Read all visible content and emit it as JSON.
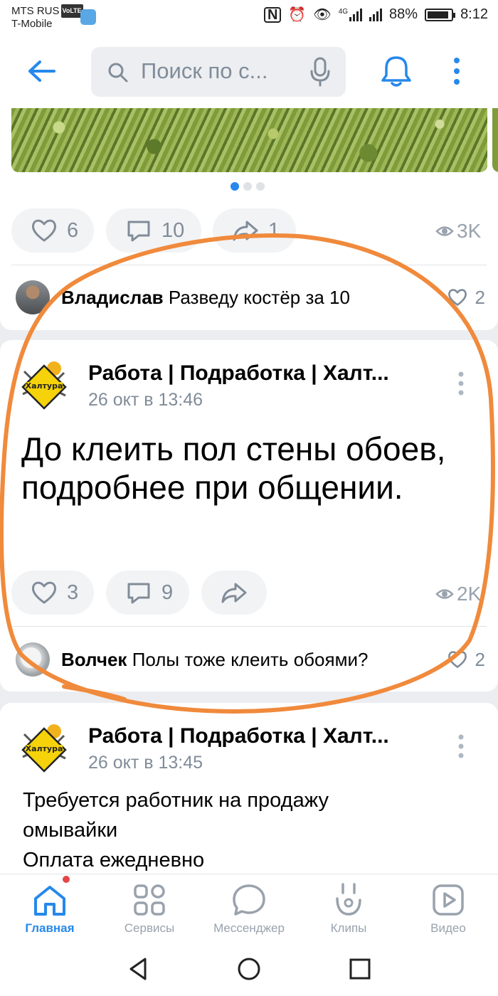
{
  "status_bar": {
    "carrier_line1": "MTS RUS",
    "carrier_badge": "VoLTE",
    "carrier_line2": "T-Mobile",
    "network": "4G",
    "battery": "88%",
    "time": "8:12"
  },
  "header": {
    "search_placeholder": "Поиск по с..."
  },
  "first_post": {
    "likes": "6",
    "comments": "10",
    "shares": "1",
    "views": "3K",
    "carousel_active_index": 0,
    "carousel_count": 3,
    "top_comment": {
      "author": "Владислав",
      "text": "Разведу костёр за 10",
      "likes": "2"
    }
  },
  "second_post": {
    "author": "Работа | Подработка | Халт...",
    "date": "26 окт в 13:46",
    "text": "До клеить пол стены обоев, подробнее при общении.",
    "likes": "3",
    "comments": "9",
    "views": "2K",
    "top_comment": {
      "author": "Волчек",
      "text": "Полы тоже клеить обоями?",
      "likes": "2"
    }
  },
  "third_post": {
    "author": "Работа | Подработка | Халт...",
    "date": "26 окт в 13:45",
    "text_lines": [
      "Требуется работник на продажу",
      "омывайки",
      "Оплата ежедневно"
    ]
  },
  "avatar_logo_text": "Халтура",
  "tab_bar": {
    "tabs": [
      {
        "label": "Главная",
        "icon": "home-icon",
        "active": true
      },
      {
        "label": "Сервисы",
        "icon": "services-icon"
      },
      {
        "label": "Мессенджер",
        "icon": "messenger-icon"
      },
      {
        "label": "Клипы",
        "icon": "clips-icon"
      },
      {
        "label": "Видео",
        "icon": "video-icon"
      }
    ]
  },
  "colors": {
    "accent": "#2688eb",
    "annotation": "#f08a3c",
    "secondary_text": "#818c99"
  }
}
